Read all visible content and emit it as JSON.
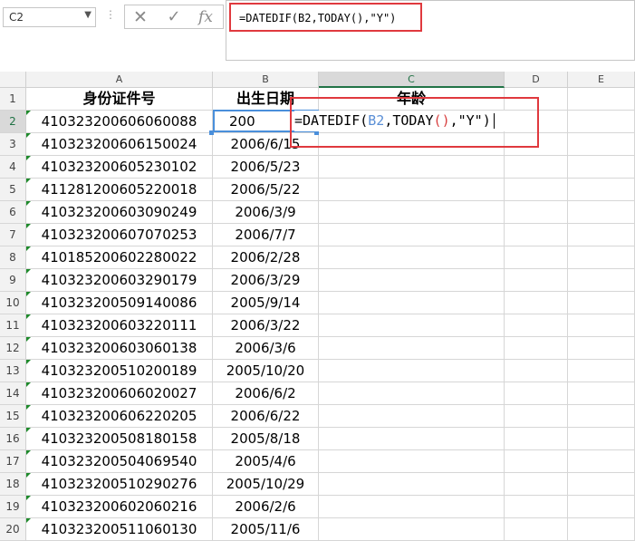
{
  "name_box": {
    "value": "C2"
  },
  "formula_bar": {
    "dots": "⋮",
    "cancel_icon": "✕",
    "enter_icon": "✓",
    "fx_label": "fx",
    "formula": "=DATEDIF(B2,TODAY(),\"Y\")"
  },
  "columns": [
    "A",
    "B",
    "C",
    "D",
    "E"
  ],
  "active_column": "C",
  "header_row": {
    "a": "身份证件号",
    "b": "出生日期",
    "c": "年龄"
  },
  "editing_cell": {
    "part1": "=DATEDIF(",
    "ref": "B2",
    "part2": ",TODAY",
    "paren_open": "(",
    "paren_close": ")",
    "part3": ",\"Y\")"
  },
  "b2_partial": "200",
  "rows": [
    {
      "num": "1"
    },
    {
      "num": "2",
      "id": "410323200606060088"
    },
    {
      "num": "3",
      "id": "410323200606150024",
      "date": "2006/6/15"
    },
    {
      "num": "4",
      "id": "410323200605230102",
      "date": "2006/5/23"
    },
    {
      "num": "5",
      "id": "411281200605220018",
      "date": "2006/5/22"
    },
    {
      "num": "6",
      "id": "410323200603090249",
      "date": "2006/3/9"
    },
    {
      "num": "7",
      "id": "410323200607070253",
      "date": "2006/7/7"
    },
    {
      "num": "8",
      "id": "410185200602280022",
      "date": "2006/2/28"
    },
    {
      "num": "9",
      "id": "410323200603290179",
      "date": "2006/3/29"
    },
    {
      "num": "10",
      "id": "410323200509140086",
      "date": "2005/9/14"
    },
    {
      "num": "11",
      "id": "410323200603220111",
      "date": "2006/3/22"
    },
    {
      "num": "12",
      "id": "410323200603060138",
      "date": "2006/3/6"
    },
    {
      "num": "13",
      "id": "410323200510200189",
      "date": "2005/10/20"
    },
    {
      "num": "14",
      "id": "410323200606020027",
      "date": "2006/6/2"
    },
    {
      "num": "15",
      "id": "410323200606220205",
      "date": "2006/6/22"
    },
    {
      "num": "16",
      "id": "410323200508180158",
      "date": "2005/8/18"
    },
    {
      "num": "17",
      "id": "410323200504069540",
      "date": "2005/4/6"
    },
    {
      "num": "18",
      "id": "410323200510290276",
      "date": "2005/10/29"
    },
    {
      "num": "19",
      "id": "410323200602060216",
      "date": "2006/2/6"
    },
    {
      "num": "20",
      "id": "410323200511060130",
      "date": "2005/11/6"
    }
  ],
  "colors": {
    "selection": "#4a8fdb",
    "highlight_box": "#e0393e",
    "error_triangle": "#1e8a2b",
    "active_header": "#217346"
  }
}
